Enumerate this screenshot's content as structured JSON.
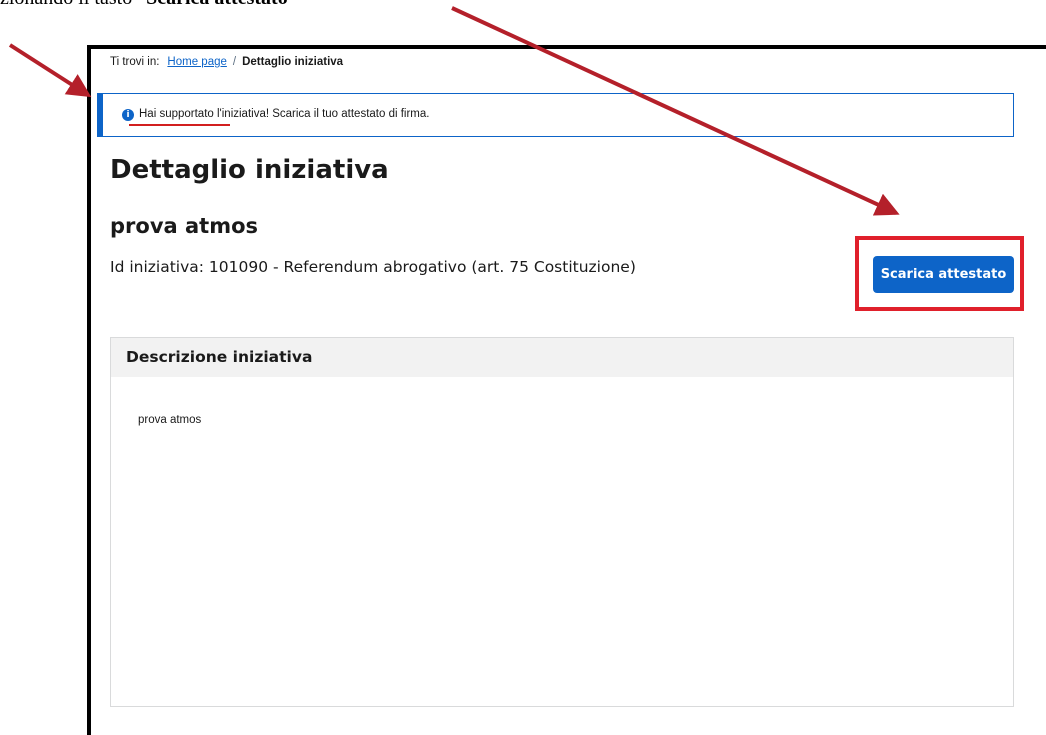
{
  "caption": {
    "prefix": "zionando il tasto “",
    "bold": "Scarica attestato",
    "suffix": "”"
  },
  "breadcrumb": {
    "prefix": "Ti trovi in:",
    "home_link": "Home page",
    "separator": "/",
    "current": "Dettaglio iniziativa"
  },
  "alert": {
    "icon": "info-icon",
    "icon_glyph": "i",
    "text": "Hai supportato l'iniziativa! Scarica il tuo attestato di firma."
  },
  "page": {
    "title": "Dettaglio iniziativa",
    "initiative_name": "prova atmos",
    "initiative_id_line": "Id iniziativa: 101090 - Referendum abrogativo (art. 75 Costituzione)"
  },
  "actions": {
    "download_label": "Scarica attestato"
  },
  "description_card": {
    "title": "Descrizione iniziativa",
    "body": "prova atmos"
  },
  "colors": {
    "primary": "#0d64c8",
    "annotation_red": "#b4202a",
    "highlight_red": "#e0202b"
  }
}
